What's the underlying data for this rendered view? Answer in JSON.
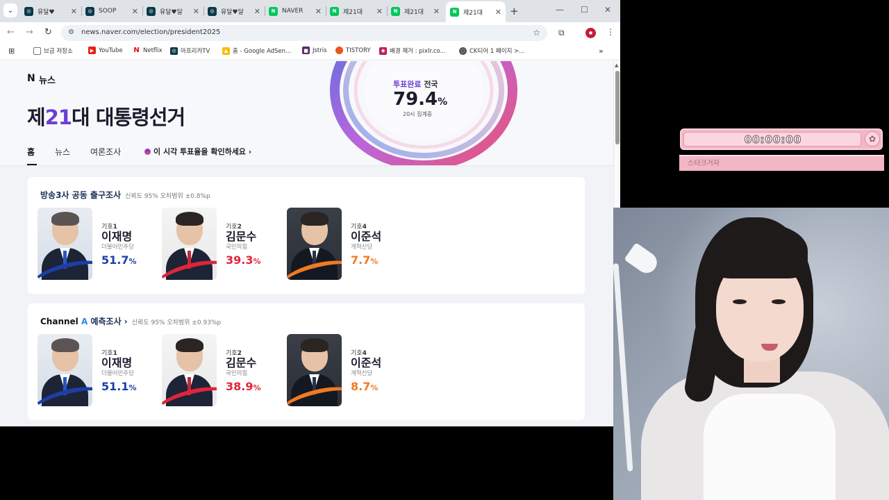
{
  "tabs": [
    {
      "title": "유달♥",
      "favicon": "SOOP",
      "color": "#0b3a4a",
      "active": false
    },
    {
      "title": "SOOP",
      "favicon": "SOOP",
      "color": "#0b3a4a",
      "active": false
    },
    {
      "title": "유달♥달",
      "favicon": "SOOP",
      "color": "#0b3a4a",
      "active": false
    },
    {
      "title": "유달♥달",
      "favicon": "SOOP",
      "color": "#0b3a4a",
      "active": false
    },
    {
      "title": "NAVER",
      "favicon": "N",
      "color": "#03c75a",
      "active": false
    },
    {
      "title": "제21대",
      "favicon": "N",
      "color": "#03c75a",
      "active": false
    },
    {
      "title": "제21대",
      "favicon": "N",
      "color": "#03c75a",
      "active": false
    },
    {
      "title": "제21대",
      "favicon": "N",
      "color": "#03c75a",
      "active": true
    }
  ],
  "url": "news.naver.com/election/president2025",
  "bookmarks": [
    {
      "label": "브금 저장소",
      "icon": "folder-icon"
    },
    {
      "label": "YouTube",
      "icon": "youtube-icon",
      "color": "#e62117"
    },
    {
      "label": "Netflix",
      "icon": "netflix-icon",
      "color": "#e50914"
    },
    {
      "label": "아프리카TV",
      "icon": "soop-icon",
      "color": "#0b3a4a"
    },
    {
      "label": "홈 - Google AdSen...",
      "icon": "adsense-icon",
      "color": "#fbbc04"
    },
    {
      "label": "Jstris",
      "icon": "jstris-icon",
      "color": "#5a2a6a"
    },
    {
      "label": "TISTORY",
      "icon": "tistory-icon",
      "color": "#eb531f"
    },
    {
      "label": "배경 제거 : pixlr.co...",
      "icon": "pixlr-icon",
      "color": "#c2185b"
    },
    {
      "label": "CK티어 1 페이지 >...",
      "icon": "globe-icon",
      "color": "#555"
    }
  ],
  "header": {
    "brand": "N",
    "brand_label": "뉴스",
    "title_pre": "제",
    "title_num": "21",
    "title_post": "대 대통령선거",
    "turnout_done": "투표완료",
    "turnout_scope": " 전국",
    "turnout_value": "79.4",
    "turnout_unit": "%",
    "turnout_time": "20시 집계중",
    "nav": [
      "홈",
      "뉴스",
      "여론조사"
    ],
    "poll_link": "이 시각 투표율을 확인하세요 ›"
  },
  "cards": [
    {
      "title": "방송3사 공동 출구조사",
      "note": "신뢰도 95% 오차범위 ±0.8%p",
      "candidates": [
        {
          "num_prefix": "기호",
          "num": "1",
          "name": "이재명",
          "party": "더불어민주당",
          "pct": "51.7",
          "unit": "%",
          "color": "#1d3ea8"
        },
        {
          "num_prefix": "기호",
          "num": "2",
          "name": "김문수",
          "party": "국민의힘",
          "pct": "39.3",
          "unit": "%",
          "color": "#e0243a"
        },
        {
          "num_prefix": "기호",
          "num": "4",
          "name": "이준석",
          "party": "개혁신당",
          "pct": "7.7",
          "unit": "%",
          "color": "#f07a22"
        }
      ]
    },
    {
      "title_brand": "Channel",
      "title_brand_a": "A",
      "title": "예측조사 ›",
      "note": "신뢰도 95% 오차범위 ±0.93%p",
      "candidates": [
        {
          "num_prefix": "기호",
          "num": "1",
          "name": "이재명",
          "party": "더불어민주당",
          "pct": "51.1",
          "unit": "%",
          "color": "#1d3ea8"
        },
        {
          "num_prefix": "기호",
          "num": "2",
          "name": "김문수",
          "party": "국민의힘",
          "pct": "38.9",
          "unit": "%",
          "color": "#e0243a"
        },
        {
          "num_prefix": "기호",
          "num": "4",
          "name": "이준석",
          "party": "개혁신당",
          "pct": "8.7",
          "unit": "%",
          "color": "#f07a22"
        }
      ]
    }
  ],
  "overlay": {
    "timer": "00:00:00",
    "banner": "스타크거자"
  }
}
